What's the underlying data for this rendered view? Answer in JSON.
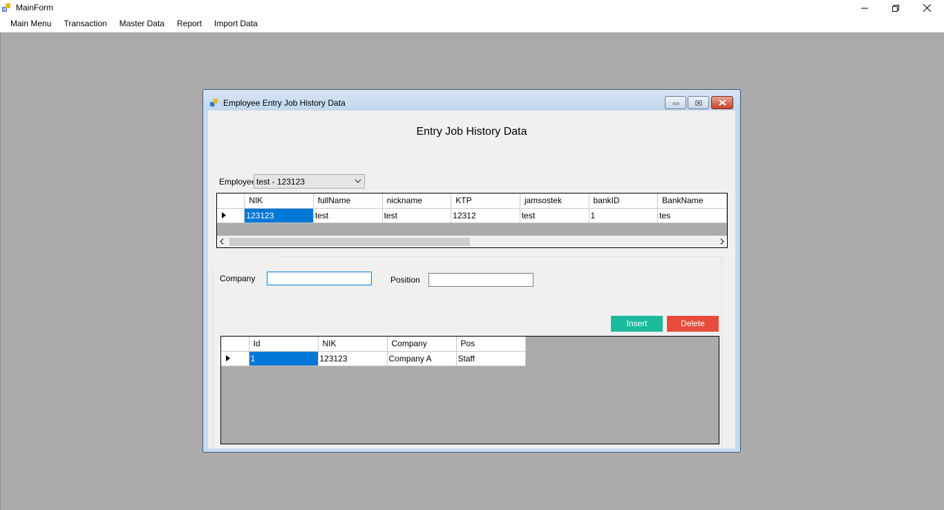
{
  "main_window": {
    "title": "MainForm"
  },
  "menu": [
    "Main Menu",
    "Transaction",
    "Master Data",
    "Report",
    "Import Data"
  ],
  "child_window": {
    "title": "Employee Entry Job History Data"
  },
  "form": {
    "heading": "Entry Job History Data",
    "employee_label": "Employee",
    "employee_value": "test - 123123",
    "company_label": "Company",
    "company_value": "",
    "position_label": "Position",
    "position_value": "",
    "insert_label": "Insert",
    "delete_label": "Delete"
  },
  "employee_grid": {
    "columns": [
      "NIK",
      "fullName",
      "nickname",
      "KTP",
      "jamsostek",
      "bankID",
      "BankName"
    ],
    "rows": [
      [
        "123123",
        "test",
        "test",
        "12312",
        "test",
        "1",
        "tes"
      ]
    ]
  },
  "history_grid": {
    "columns": [
      "Id",
      "NIK",
      "Company",
      "Pos"
    ],
    "rows": [
      [
        "1",
        "123123",
        "Company A",
        "Staff"
      ]
    ]
  },
  "colors": {
    "insert": "#1abc9c",
    "delete": "#e74c3c",
    "selection": "#0078d7",
    "mdi_background": "#ababab"
  },
  "icons": [
    "app-icon",
    "minimize-icon",
    "restore-icon",
    "close-icon",
    "dropdown-arrow-icon",
    "row-pointer-icon",
    "scroll-left-icon",
    "scroll-right-icon"
  ]
}
